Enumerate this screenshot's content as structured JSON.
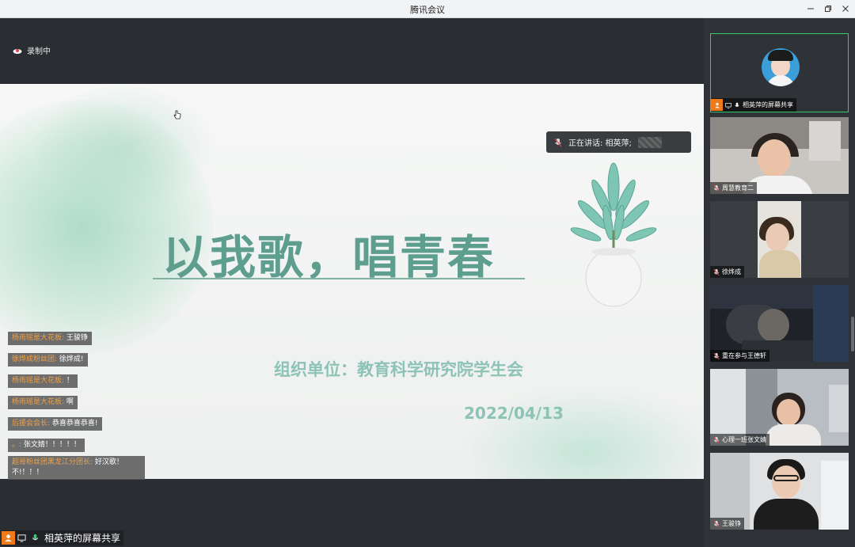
{
  "window": {
    "title": "腾讯会议",
    "controls": [
      "minimize",
      "maximize",
      "close"
    ]
  },
  "recording": {
    "label": "录制中",
    "icon": "cloud-record-icon"
  },
  "slide": {
    "title": "以我歌，唱青春",
    "organizer": "组织单位：教育科学研究院学生会",
    "date": "2022/04/13"
  },
  "speaking": {
    "label": "正在讲话: 相英萍;"
  },
  "chat": [
    {
      "sender": "杨雨瑶是大花板:",
      "text": "王骏铮"
    },
    {
      "sender": "徐烨成粉丝团:",
      "text": "徐烨成!"
    },
    {
      "sender": "杨雨瑶是大花板:",
      "text": "！"
    },
    {
      "sender": "杨雨瑶是大花板:",
      "text": "啊"
    },
    {
      "sender": "后援会会长:",
      "text": "恭喜恭喜恭喜!"
    },
    {
      "sender": "。:",
      "text": "张文婧！！！！！"
    },
    {
      "sender": "超哥粉丝团黑龙江分团长:",
      "text": "好汉歌！不!！！！"
    }
  ],
  "presenter": {
    "name": "相英萍的屏幕共享"
  },
  "participants": [
    {
      "name": "相英萍的屏幕共享",
      "active": true
    },
    {
      "name": "周慧教育二",
      "active": false
    },
    {
      "name": "徐烨成",
      "active": false
    },
    {
      "name": "重在参与王德轩",
      "active": false
    },
    {
      "name": "心理一班张文婧",
      "active": false
    },
    {
      "name": "王骏铮",
      "active": false
    }
  ],
  "colors": {
    "accent_green": "#38c86d",
    "title_green": "#5e9e8e",
    "chat_sender": "#f0a24a",
    "presenter_orange": "#f07a1a"
  }
}
